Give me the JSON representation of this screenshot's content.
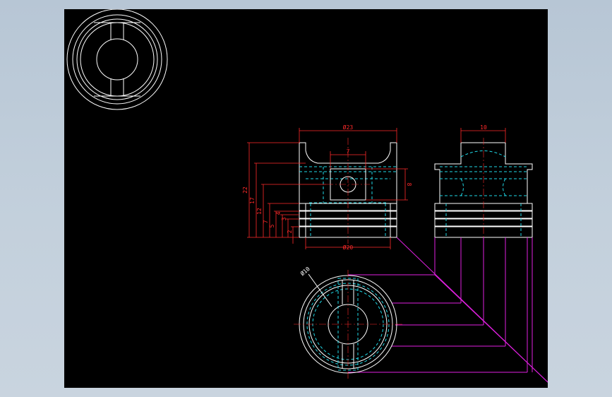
{
  "drawing": {
    "background": "#000000",
    "colors": {
      "outline": "#ffffff",
      "dimension": "#ff2a2a",
      "hidden": "#1fd8e6",
      "projection": "#e020e0"
    }
  },
  "front_view": {
    "dims": {
      "top_diameter": "Ø23",
      "bottom_diameter": "Ø20",
      "pin_hole_width": "7",
      "pin_hole_height": "8",
      "heights": [
        "22",
        "17",
        "12",
        "7",
        "5",
        "4",
        "3",
        "2"
      ]
    }
  },
  "side_view": {
    "dims": {
      "width": "10"
    }
  },
  "bottom_view": {
    "dims": {
      "bore_diameter": "Ø10"
    }
  }
}
